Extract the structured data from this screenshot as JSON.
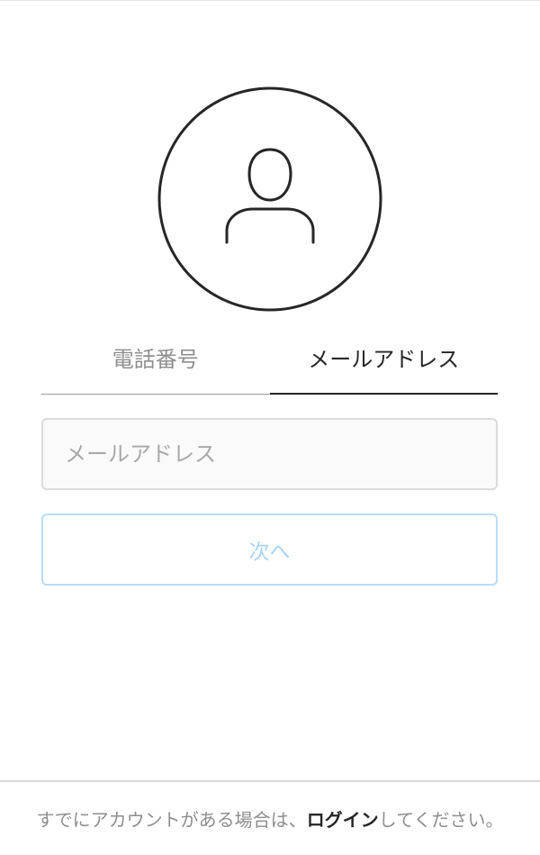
{
  "avatar": {
    "icon": "user-silhouette-icon"
  },
  "tabs": [
    {
      "label": "電話番号",
      "selected": false
    },
    {
      "label": "メールアドレス",
      "selected": true
    }
  ],
  "email_input": {
    "placeholder": "メールアドレス",
    "value": ""
  },
  "next_button": {
    "label": "次へ",
    "enabled": false
  },
  "footer": {
    "prefix": "すでにアカウントがある場合は、",
    "login_link": "ログイン",
    "suffix": "してください。"
  },
  "colors": {
    "text_primary": "#262626",
    "text_secondary": "#8e8e8e",
    "button_disabled": "#a9d3f7",
    "border": "#dbdbdb"
  }
}
